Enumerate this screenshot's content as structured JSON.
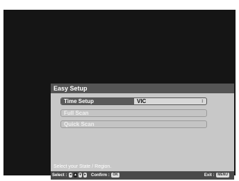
{
  "dialog": {
    "title": "Easy Setup",
    "items": [
      {
        "label": "Time Setup",
        "value": "VIC",
        "arrows": "↕"
      },
      {
        "label": "Full Scan"
      },
      {
        "label": "Quick Scan"
      }
    ],
    "hint": "Select your State / Region."
  },
  "footer": {
    "select_label": "Select :",
    "confirm_label": "Confirm :",
    "confirm_key": "OK",
    "exit_label": "Exit :",
    "exit_key": "MENU"
  }
}
